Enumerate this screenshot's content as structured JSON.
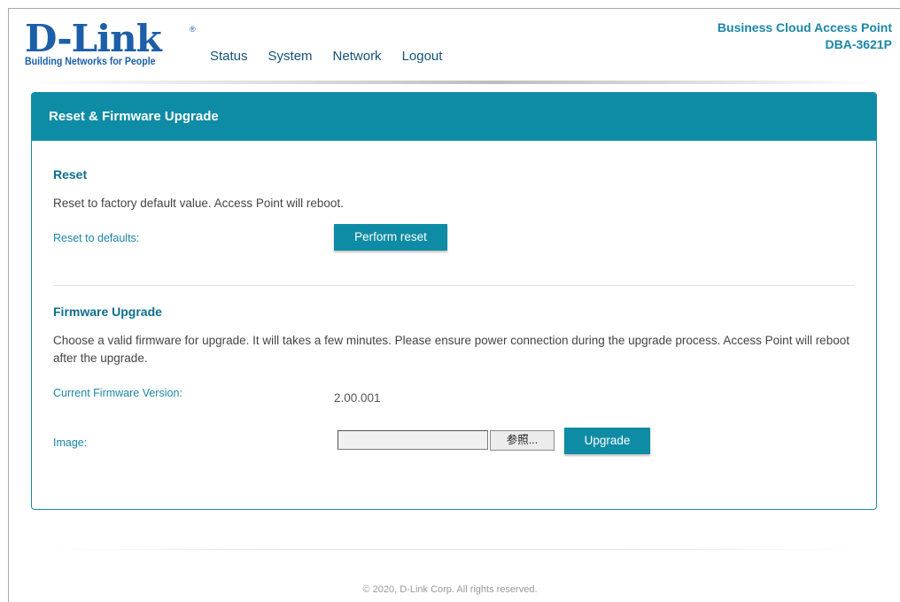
{
  "brand": {
    "logo_text": "D-Link",
    "tagline": "Building Networks for People",
    "color": "#1c5fa8"
  },
  "nav": [
    "Status",
    "System",
    "Network",
    "Logout"
  ],
  "product": {
    "name": "Business Cloud Access Point",
    "model": "DBA-3621P"
  },
  "panel": {
    "title": "Reset & Firmware Upgrade",
    "accent": "#0f8ca5"
  },
  "reset": {
    "title": "Reset",
    "description": "Reset to factory default value. Access Point will reboot.",
    "label": "Reset to defaults:",
    "button": "Perform reset"
  },
  "firmware": {
    "title": "Firmware Upgrade",
    "description": "Choose a valid firmware for upgrade. It will takes a few minutes. Please ensure power connection during the upgrade process. Access Point will reboot after the upgrade.",
    "version_label": "Current Firmware Version:",
    "version_value": "2.00.001",
    "image_label": "Image:",
    "file_value": "",
    "browse_button": "参照...",
    "upgrade_button": "Upgrade"
  },
  "footer": "© 2020, D-Link Corp. All rights reserved."
}
